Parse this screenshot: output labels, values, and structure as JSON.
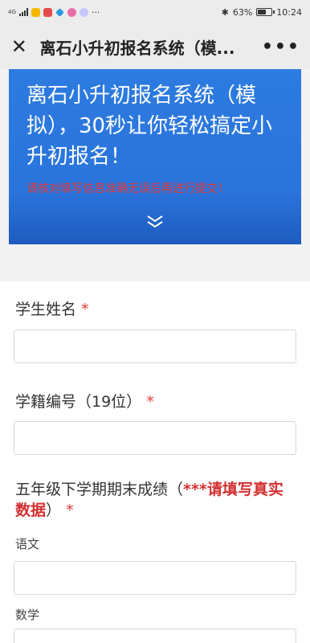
{
  "status_bar": {
    "signal_text": "4G",
    "battery_percent": "63%",
    "time": "10:24",
    "battery_level": 0.63
  },
  "nav": {
    "title": "离石小升初报名系统（模..."
  },
  "banner": {
    "title": "离石小升初报名系统（模拟），30秒让你轻松搞定小升初报名！",
    "note": "请核对填写信息准确无误后再进行提交！"
  },
  "form": {
    "q1_label": "学生姓名",
    "q2_label": "学籍编号（19位）",
    "q3_label_part1": "五年级下学期期末成绩（",
    "q3_highlight": "***请填写真实数据",
    "q3_label_part2": "）",
    "required_mark": "*",
    "sub_chinese": "语文",
    "sub_math": "数学"
  }
}
